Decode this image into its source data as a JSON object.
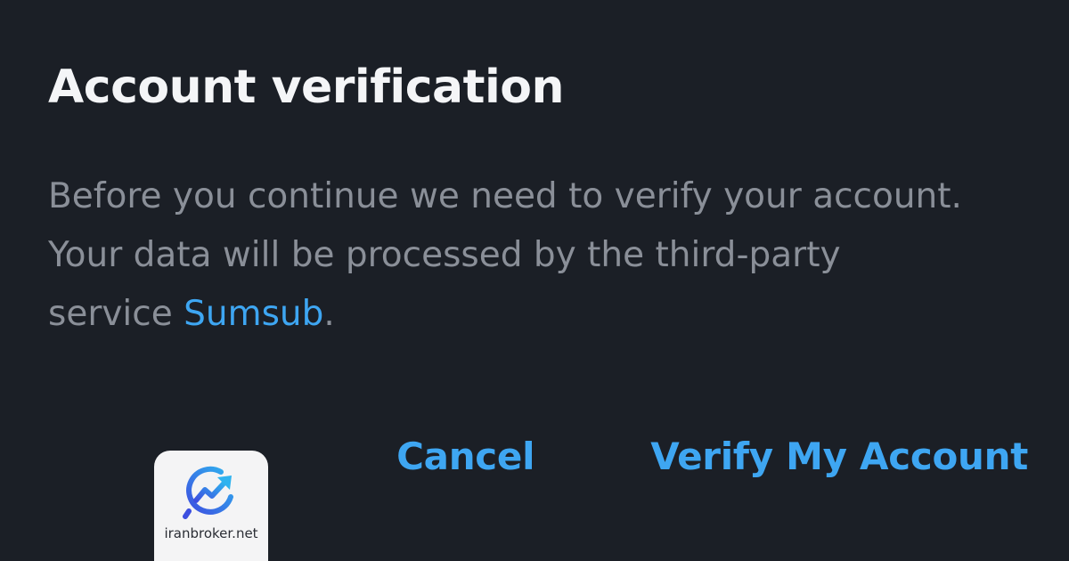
{
  "dialog": {
    "title": "Account verification",
    "body": {
      "line1": "Before you continue we need to verify your account.",
      "line2": "Your data will be processed by the third-party",
      "line3_prefix": "service ",
      "link_text": "Sumsub",
      "line3_suffix": "."
    },
    "actions": {
      "cancel_label": "Cancel",
      "verify_label": "Verify My Account"
    }
  },
  "watermark": {
    "text": "iranbroker.net",
    "icon": "trend-arrow-logo-icon"
  },
  "colors": {
    "background": "#1b1f26",
    "title": "#f4f5f7",
    "body_text": "#8a8f98",
    "accent": "#3ea6f2",
    "watermark_bg": "#f4f4f5",
    "logo_blue": "#3d4fe0",
    "logo_cyan": "#2fb3ef"
  }
}
